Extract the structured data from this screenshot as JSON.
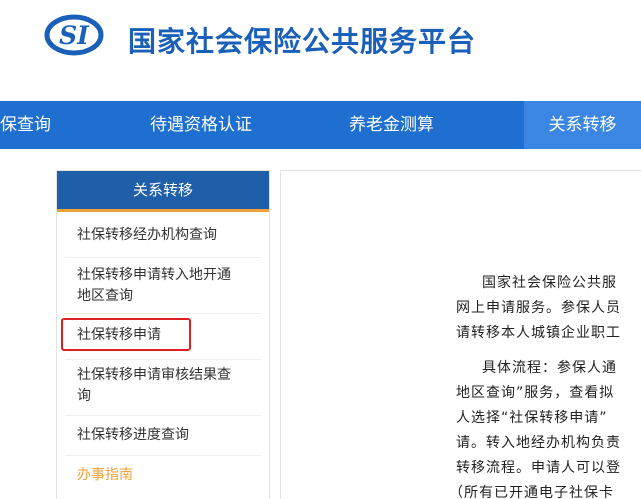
{
  "header": {
    "logo_text": "SI",
    "site_title": "国家社会保险公共服务平台"
  },
  "nav": {
    "items": [
      {
        "label": "保查询"
      },
      {
        "label": "待遇资格认证"
      },
      {
        "label": "养老金测算"
      },
      {
        "label": "关系转移",
        "active": true
      }
    ]
  },
  "sidebar": {
    "heading": "关系转移",
    "links": [
      {
        "lines": [
          "社保转移经办机构查询"
        ]
      },
      {
        "lines": [
          "社保转移申请转入地开通",
          "地区查询"
        ]
      },
      {
        "lines": [
          "社保转移申请"
        ],
        "highlighted": true
      },
      {
        "lines": [
          "社保转移申请审核结果查",
          "询"
        ]
      },
      {
        "lines": [
          "社保转移进度查询"
        ]
      }
    ],
    "guide_label": "办事指南"
  },
  "content": {
    "lines": [
      "国家社会保险公共服",
      "网上申请服务。参保人员",
      "请转移本人城镇企业职工",
      "具体流程：参保人通",
      "地区查询”服务，查看拟",
      "人选择“社保转移申请”",
      "请。转入地经办机构负责",
      "转移流程。申请人可以登",
      "（所有已开通电子社保卡"
    ]
  },
  "colors": {
    "brand_blue": "#1a5fb8",
    "nav_blue": "#1f6fd0",
    "nav_active": "#3b86e3",
    "sidebar_head": "#1f5ea8",
    "accent_orange": "#f0a23a",
    "highlight_red": "#e02020"
  }
}
